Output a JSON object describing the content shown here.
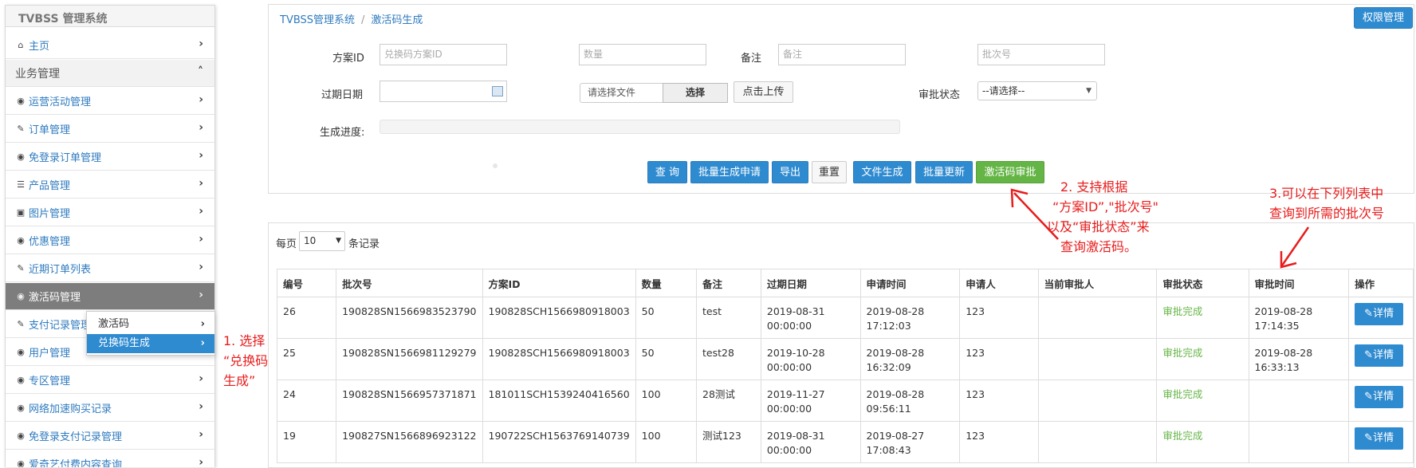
{
  "app_title": "TVBSS 管理系统",
  "sidebar": {
    "items": [
      {
        "label": "主页",
        "icon": "home-icon",
        "glyph": "⌂"
      },
      {
        "label": "业务管理",
        "icon": "chevron-up-icon"
      },
      {
        "label": "运营活动管理",
        "icon": "eye-icon",
        "glyph": "◉"
      },
      {
        "label": "订单管理",
        "icon": "edit-icon",
        "glyph": "✎"
      },
      {
        "label": "免登录订单管理",
        "icon": "eye-icon",
        "glyph": "◉"
      },
      {
        "label": "产品管理",
        "icon": "list-icon",
        "glyph": "☰"
      },
      {
        "label": "图片管理",
        "icon": "image-icon",
        "glyph": "▣"
      },
      {
        "label": "优惠管理",
        "icon": "eye-icon",
        "glyph": "◉"
      },
      {
        "label": "近期订单列表",
        "icon": "edit-icon",
        "glyph": "✎"
      },
      {
        "label": "激活码管理",
        "icon": "eye-icon",
        "glyph": "◉"
      },
      {
        "label": "支付记录管理",
        "icon": "edit-icon",
        "glyph": "✎"
      },
      {
        "label": "用户管理",
        "icon": "eye-icon",
        "glyph": "◉"
      },
      {
        "label": "专区管理",
        "icon": "eye-icon",
        "glyph": "◉"
      },
      {
        "label": "网络加速购买记录",
        "icon": "eye-icon",
        "glyph": "◉"
      },
      {
        "label": "免登录支付记录管理",
        "icon": "eye-icon",
        "glyph": "◉"
      },
      {
        "label": "爱奇艺付费内容查询",
        "icon": "eye-icon",
        "glyph": "◉"
      }
    ],
    "submenu": [
      "激活码",
      "兑换码生成"
    ]
  },
  "breadcrumb": {
    "root": "TVBSS管理系统",
    "current": "激活码生成"
  },
  "header": {
    "perm_button": "权限管理"
  },
  "form": {
    "scheme_label": "方案ID",
    "scheme_placeholder": "兑换码方案ID",
    "qty_placeholder": "数量",
    "remark_label": "备注",
    "remark_placeholder": "备注",
    "batch_placeholder": "批次号",
    "expire_label": "过期日期",
    "file_placeholder": "请选择文件",
    "choose_btn": "选择",
    "upload_btn": "点击上传",
    "approval_label": "审批状态",
    "approval_selected": "--请选择--",
    "progress_label": "生成进度:",
    "progress_value": 0
  },
  "actions": [
    "查 询",
    "批量生成申请",
    "导出",
    "重置",
    "文件生成",
    "批量更新",
    "激活码审批"
  ],
  "table": {
    "per_page_prefix": "每页",
    "per_page_value": "10",
    "per_page_suffix": "条记录",
    "columns": [
      "编号",
      "批次号",
      "方案ID",
      "数量",
      "备注",
      "过期日期",
      "申请时间",
      "申请人",
      "当前审批人",
      "审批状态",
      "审批时间",
      "操作"
    ],
    "rows": [
      [
        "26",
        "190828SN1566983523790",
        "190828SCH1566980918003",
        "50",
        "test",
        "2019-08-31 00:00:00",
        "2019-08-28 17:12:03",
        "123",
        "",
        "审批完成",
        "2019-08-28 17:14:35",
        "详情"
      ],
      [
        "25",
        "190828SN1566981129279",
        "190828SCH1566980918003",
        "50",
        "test28",
        "2019-10-28 00:00:00",
        "2019-08-28 16:32:09",
        "123",
        "",
        "审批完成",
        "2019-08-28 16:33:13",
        "详情"
      ],
      [
        "24",
        "190828SN1566957371871",
        "181011SCH1539240416560",
        "100",
        "28测试",
        "2019-11-27 00:00:00",
        "2019-08-28 09:56:11",
        "123",
        "",
        "审批完成",
        "",
        "详情"
      ],
      [
        "19",
        "190827SN1566896923122",
        "190722SCH1563769140739",
        "100",
        "测试123",
        "2019-08-31 00:00:00",
        "2019-08-27 17:08:43",
        "123",
        "",
        "审批完成",
        "",
        "详情"
      ]
    ]
  },
  "annotations": {
    "note1": [
      "1. 选择",
      "“兑换码",
      "生成”"
    ],
    "note2": [
      "2. 支持根据",
      "“方案ID”,\"批次号\"",
      "以及“审批状态”来",
      "查询激活码。"
    ],
    "note3": [
      "3.可以在下列列表中",
      "查询到所需的批次号"
    ],
    "color": "#e81c1c"
  },
  "colors": {
    "primary": "#2f8bd0",
    "success": "#65b546",
    "active_menu": "#7d7d7d"
  }
}
